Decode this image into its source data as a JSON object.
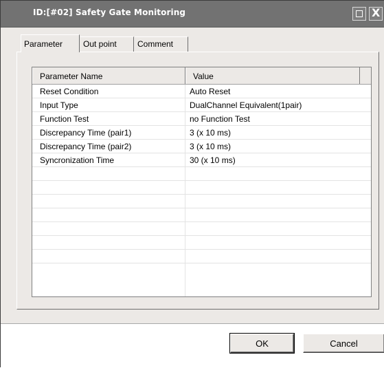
{
  "window": {
    "title": "ID:[#02]  Safety Gate Monitoring",
    "maximize_icon": "maximize-icon",
    "close_icon": "close-icon",
    "close_glyph": "X"
  },
  "tabs": [
    {
      "label": "Parameter",
      "active": true
    },
    {
      "label": "Out point",
      "active": false
    },
    {
      "label": "Comment",
      "active": false
    }
  ],
  "table": {
    "headers": [
      "Parameter Name",
      "Value"
    ],
    "rows": [
      {
        "name": "Reset Condition",
        "value": "Auto Reset"
      },
      {
        "name": "Input Type",
        "value": "DualChannel Equivalent(1pair)"
      },
      {
        "name": "Function Test",
        "value": "no Function Test"
      },
      {
        "name": "Discrepancy Time (pair1)",
        "value": "3 (x 10 ms)"
      },
      {
        "name": "Discrepancy Time (pair2)",
        "value": "3 (x 10 ms)"
      },
      {
        "name": "Syncronization Time",
        "value": "30 (x 10 ms)"
      },
      {
        "name": "",
        "value": ""
      },
      {
        "name": "",
        "value": ""
      },
      {
        "name": "",
        "value": ""
      },
      {
        "name": "",
        "value": ""
      },
      {
        "name": "",
        "value": ""
      },
      {
        "name": "",
        "value": ""
      },
      {
        "name": "",
        "value": ""
      }
    ]
  },
  "buttons": {
    "ok": "OK",
    "cancel": "Cancel"
  },
  "colors": {
    "titlebar": "#727272",
    "dialog_bg": "#ece9e6",
    "list_bg": "#ffffff"
  }
}
